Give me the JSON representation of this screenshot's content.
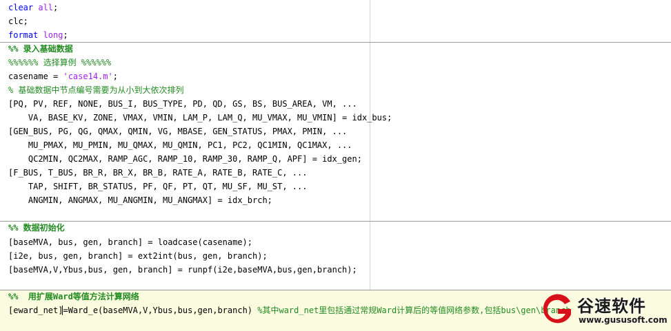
{
  "code": {
    "l1_kw": "clear",
    "l1_arg": " all",
    "l1_end": ";",
    "l2": "clc;",
    "l3_kw": "format",
    "l3_arg": " long",
    "l3_end": ";",
    "l4_cell": "%% 录入基础数据",
    "l5_comment": "%%%%%% 选择算例 %%%%%%",
    "l6_pre": "casename = ",
    "l6_str": "'case14.m'",
    "l6_end": ";",
    "l7_comment": "% 基础数据中节点编号需要为从小到大依次排列",
    "l8": "[PQ, PV, REF, NONE, BUS_I, BUS_TYPE, PD, QD, GS, BS, BUS_AREA, VM, ...",
    "l9": "    VA, BASE_KV, ZONE, VMAX, VMIN, LAM_P, LAM_Q, MU_VMAX, MU_VMIN] = idx_bus;",
    "l10": "[GEN_BUS, PG, QG, QMAX, QMIN, VG, MBASE, GEN_STATUS, PMAX, PMIN, ...",
    "l11": "    MU_PMAX, MU_PMIN, MU_QMAX, MU_QMIN, PC1, PC2, QC1MIN, QC1MAX, ...",
    "l12": "    QC2MIN, QC2MAX, RAMP_AGC, RAMP_10, RAMP_30, RAMP_Q, APF] = idx_gen;",
    "l13": "[F_BUS, T_BUS, BR_R, BR_X, BR_B, RATE_A, RATE_B, RATE_C, ...",
    "l14": "    TAP, SHIFT, BR_STATUS, PF, QF, PT, QT, MU_SF, MU_ST, ...",
    "l15": "    ANGMIN, ANGMAX, MU_ANGMIN, MU_ANGMAX] = idx_brch;",
    "l16_cell": "%% 数据初始化",
    "l17": "[baseMVA, bus, gen, branch] = loadcase(casename);",
    "l18": "[i2e, bus, gen, branch] = ext2int(bus, gen, branch);",
    "l19": "[baseMVA,V,Ybus,bus, gen, branch] = runpf(i2e,baseMVA,bus,gen,branch);",
    "l20_cell": "%%  用扩展Ward等值方法计算网络",
    "l21_a": "[eward_net]",
    "l21_b": "=Ward_e(baseMVA,V,Ybus,bus,gen,branch) ",
    "l21_comment": "%其中ward_net里包括通过常规Ward计算后的等值网络参数,包括bus\\gen\\branch"
  },
  "watermark": {
    "title": "谷速软件",
    "url": "www.gususoft.com"
  },
  "colors": {
    "keyword": "#0000ff",
    "string": "#a020f0",
    "comment": "#228b22",
    "cell_highlight": "#fbfbdf",
    "logo_red": "#d7101a"
  }
}
